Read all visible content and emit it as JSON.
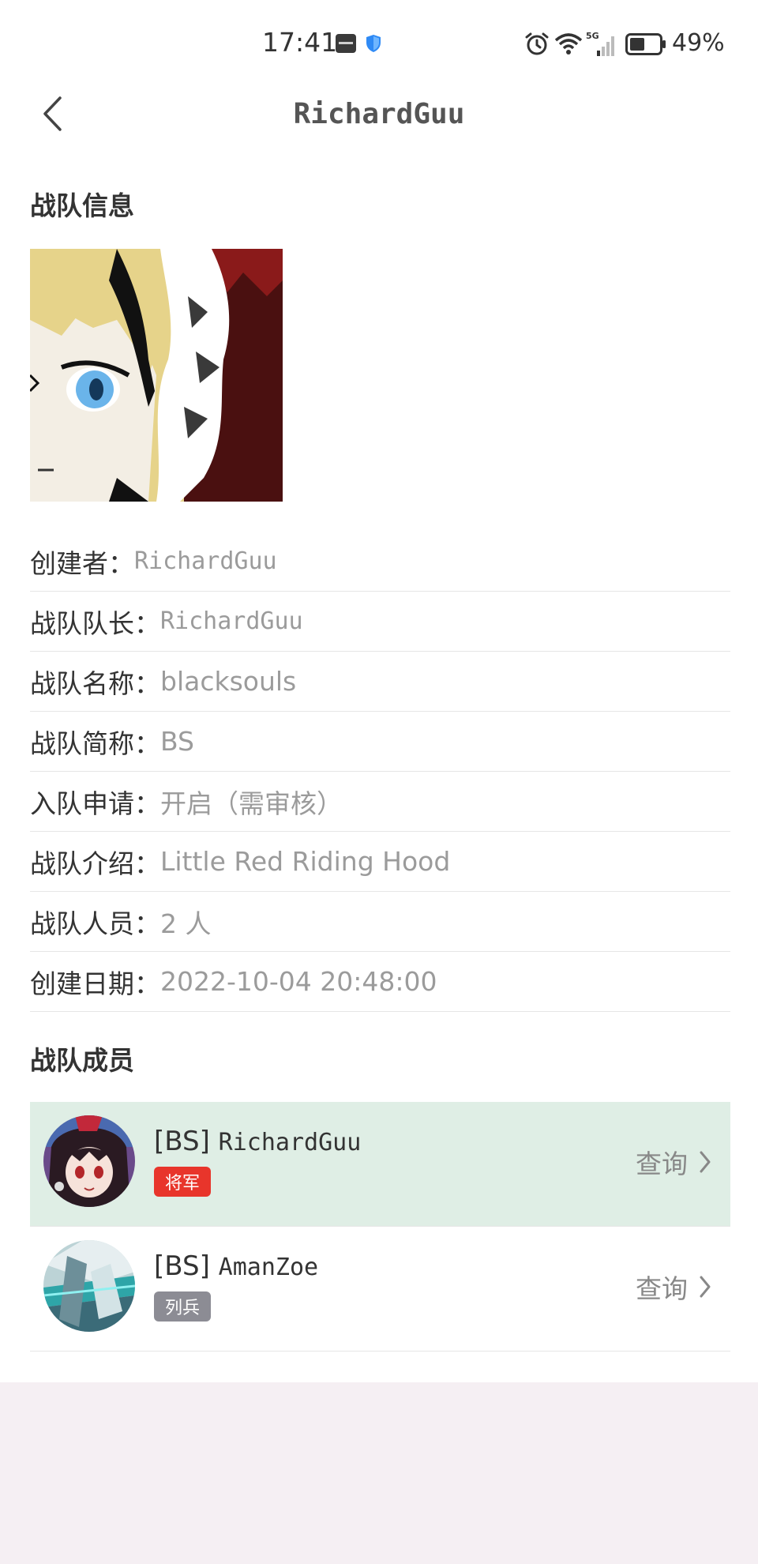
{
  "status_bar": {
    "time": "17:41",
    "battery_pct": "49%",
    "icons": [
      "app-notification-icon",
      "shield-icon",
      "alarm-icon",
      "wifi-icon",
      "signal-5g-icon",
      "battery-icon"
    ]
  },
  "header": {
    "title": "RichardGuu",
    "back_icon": "chevron-left-icon"
  },
  "team_info": {
    "section_title": "战队信息",
    "rows": [
      {
        "label": "创建者：",
        "value": "RichardGuu"
      },
      {
        "label": "战队队长：",
        "value": "RichardGuu"
      },
      {
        "label": "战队名称：",
        "value": "blacksouls"
      },
      {
        "label": "战队简称：",
        "value": "BS"
      },
      {
        "label": "入队申请：",
        "value": "开启（需审核）"
      },
      {
        "label": "战队介绍：",
        "value": "Little Red Riding Hood"
      },
      {
        "label": "战队人员：",
        "value": "2 人"
      },
      {
        "label": "创建日期：",
        "value": "2022-10-04 20:48:00"
      }
    ]
  },
  "members": {
    "section_title": "战队成员",
    "items": [
      {
        "tag": "[BS]",
        "name": "RichardGuu",
        "rank": "将军",
        "action": "查询",
        "highlighted": true
      },
      {
        "tag": "[BS]",
        "name": "AmanZoe",
        "rank": "列兵",
        "action": "查询",
        "highlighted": false
      }
    ]
  },
  "colors": {
    "highlight_row": "#dfeee5",
    "rank_general": "#e8352b",
    "rank_private": "#8c8c94",
    "value_text": "#9b9b9b",
    "bottom_area": "#f5eff3"
  }
}
